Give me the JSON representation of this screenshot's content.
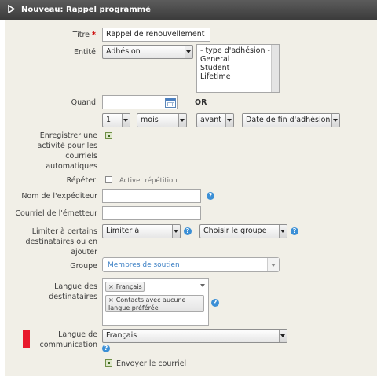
{
  "title": "Nouveau: Rappel programmé",
  "form": {
    "titre": {
      "label": "Titre",
      "required_mark": "*",
      "value": "Rappel de renouvellement"
    },
    "entite": {
      "label": "Entité",
      "selected": "Adhésion",
      "options": [
        "- type d'adhésion -",
        "General",
        "Student",
        "Lifetime"
      ]
    },
    "quand": {
      "label": "Quand",
      "date_value": "",
      "or_label": "OR",
      "number": "1",
      "unit": "mois",
      "direction": "avant",
      "reference": "Date de fin d'adhésion"
    },
    "enregistrer": {
      "label": "Enregistrer une activité pour les courriels automatiques",
      "checked": true
    },
    "repeter": {
      "label": "Répéter",
      "checkbox_label": "Activer répétition",
      "checked": false
    },
    "expediteur": {
      "label": "Nom de l'expéditeur",
      "value": ""
    },
    "courriel_emetteur": {
      "label": "Courriel de l'émetteur",
      "value": ""
    },
    "limiter": {
      "label": "Limiter à certains destinataires ou en ajouter",
      "select1": "Limiter à",
      "select2": "Choisir le groupe"
    },
    "groupe": {
      "label": "Groupe",
      "value": "Membres de soutien"
    },
    "langue_destinataires": {
      "label": "Langue des destinataires",
      "tags": [
        "Français",
        "Contacts avec aucune langue préférée"
      ]
    },
    "langue_communication": {
      "label": "Langue de communication",
      "value": "Français"
    },
    "envoyer": {
      "label": "Envoyer le courriel",
      "checked": true
    }
  },
  "colors": {
    "accent": "#3b8fd6",
    "required": "#cc0000",
    "highlight": "#e8192c",
    "panel": "#f1efe7"
  }
}
